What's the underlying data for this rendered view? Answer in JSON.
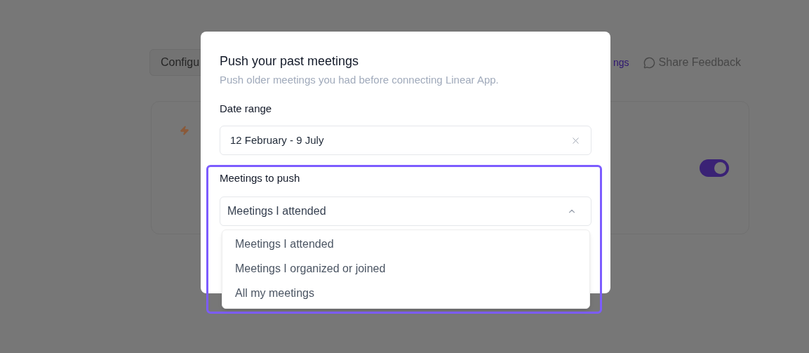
{
  "background": {
    "configure_button": "Configu",
    "settings_link": "ngs",
    "feedback_link": "Share Feedback",
    "toggle": {
      "on": true
    }
  },
  "dialog": {
    "title": "Push your past meetings",
    "subtitle": "Push older meetings you had before connecting Linear App.",
    "date_range": {
      "label": "Date range",
      "value": "12 February - 9 July"
    },
    "meetings_select": {
      "label": "Meetings to push",
      "value": "Meetings I attended",
      "expanded": true,
      "options": [
        {
          "label": "Meetings I attended"
        },
        {
          "label": "Meetings I organized or joined"
        },
        {
          "label": "All my meetings"
        }
      ]
    }
  }
}
